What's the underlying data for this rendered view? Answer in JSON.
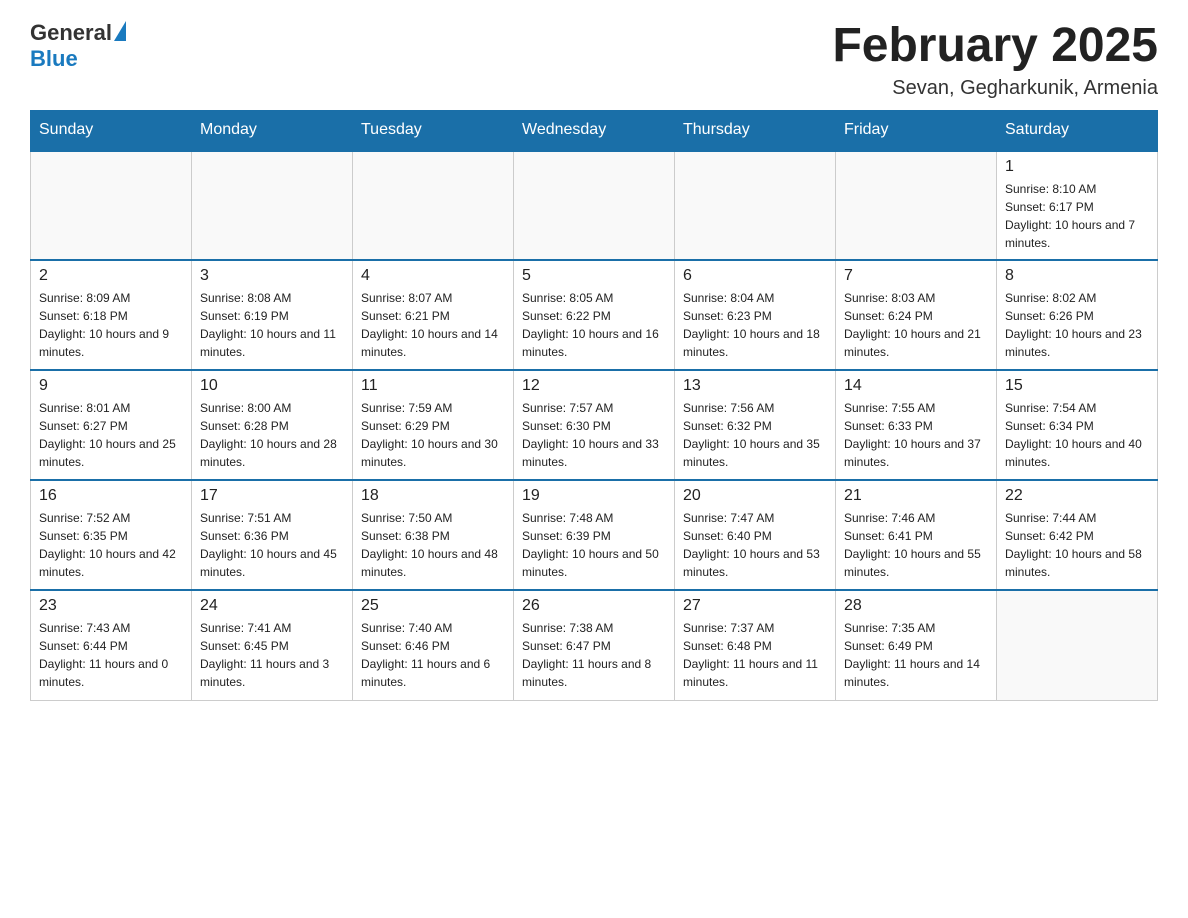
{
  "header": {
    "logo_general": "General",
    "logo_blue": "Blue",
    "month_title": "February 2025",
    "location": "Sevan, Gegharkunik, Armenia"
  },
  "days_of_week": [
    "Sunday",
    "Monday",
    "Tuesday",
    "Wednesday",
    "Thursday",
    "Friday",
    "Saturday"
  ],
  "weeks": [
    [
      {
        "day": "",
        "info": ""
      },
      {
        "day": "",
        "info": ""
      },
      {
        "day": "",
        "info": ""
      },
      {
        "day": "",
        "info": ""
      },
      {
        "day": "",
        "info": ""
      },
      {
        "day": "",
        "info": ""
      },
      {
        "day": "1",
        "info": "Sunrise: 8:10 AM\nSunset: 6:17 PM\nDaylight: 10 hours and 7 minutes."
      }
    ],
    [
      {
        "day": "2",
        "info": "Sunrise: 8:09 AM\nSunset: 6:18 PM\nDaylight: 10 hours and 9 minutes."
      },
      {
        "day": "3",
        "info": "Sunrise: 8:08 AM\nSunset: 6:19 PM\nDaylight: 10 hours and 11 minutes."
      },
      {
        "day": "4",
        "info": "Sunrise: 8:07 AM\nSunset: 6:21 PM\nDaylight: 10 hours and 14 minutes."
      },
      {
        "day": "5",
        "info": "Sunrise: 8:05 AM\nSunset: 6:22 PM\nDaylight: 10 hours and 16 minutes."
      },
      {
        "day": "6",
        "info": "Sunrise: 8:04 AM\nSunset: 6:23 PM\nDaylight: 10 hours and 18 minutes."
      },
      {
        "day": "7",
        "info": "Sunrise: 8:03 AM\nSunset: 6:24 PM\nDaylight: 10 hours and 21 minutes."
      },
      {
        "day": "8",
        "info": "Sunrise: 8:02 AM\nSunset: 6:26 PM\nDaylight: 10 hours and 23 minutes."
      }
    ],
    [
      {
        "day": "9",
        "info": "Sunrise: 8:01 AM\nSunset: 6:27 PM\nDaylight: 10 hours and 25 minutes."
      },
      {
        "day": "10",
        "info": "Sunrise: 8:00 AM\nSunset: 6:28 PM\nDaylight: 10 hours and 28 minutes."
      },
      {
        "day": "11",
        "info": "Sunrise: 7:59 AM\nSunset: 6:29 PM\nDaylight: 10 hours and 30 minutes."
      },
      {
        "day": "12",
        "info": "Sunrise: 7:57 AM\nSunset: 6:30 PM\nDaylight: 10 hours and 33 minutes."
      },
      {
        "day": "13",
        "info": "Sunrise: 7:56 AM\nSunset: 6:32 PM\nDaylight: 10 hours and 35 minutes."
      },
      {
        "day": "14",
        "info": "Sunrise: 7:55 AM\nSunset: 6:33 PM\nDaylight: 10 hours and 37 minutes."
      },
      {
        "day": "15",
        "info": "Sunrise: 7:54 AM\nSunset: 6:34 PM\nDaylight: 10 hours and 40 minutes."
      }
    ],
    [
      {
        "day": "16",
        "info": "Sunrise: 7:52 AM\nSunset: 6:35 PM\nDaylight: 10 hours and 42 minutes."
      },
      {
        "day": "17",
        "info": "Sunrise: 7:51 AM\nSunset: 6:36 PM\nDaylight: 10 hours and 45 minutes."
      },
      {
        "day": "18",
        "info": "Sunrise: 7:50 AM\nSunset: 6:38 PM\nDaylight: 10 hours and 48 minutes."
      },
      {
        "day": "19",
        "info": "Sunrise: 7:48 AM\nSunset: 6:39 PM\nDaylight: 10 hours and 50 minutes."
      },
      {
        "day": "20",
        "info": "Sunrise: 7:47 AM\nSunset: 6:40 PM\nDaylight: 10 hours and 53 minutes."
      },
      {
        "day": "21",
        "info": "Sunrise: 7:46 AM\nSunset: 6:41 PM\nDaylight: 10 hours and 55 minutes."
      },
      {
        "day": "22",
        "info": "Sunrise: 7:44 AM\nSunset: 6:42 PM\nDaylight: 10 hours and 58 minutes."
      }
    ],
    [
      {
        "day": "23",
        "info": "Sunrise: 7:43 AM\nSunset: 6:44 PM\nDaylight: 11 hours and 0 minutes."
      },
      {
        "day": "24",
        "info": "Sunrise: 7:41 AM\nSunset: 6:45 PM\nDaylight: 11 hours and 3 minutes."
      },
      {
        "day": "25",
        "info": "Sunrise: 7:40 AM\nSunset: 6:46 PM\nDaylight: 11 hours and 6 minutes."
      },
      {
        "day": "26",
        "info": "Sunrise: 7:38 AM\nSunset: 6:47 PM\nDaylight: 11 hours and 8 minutes."
      },
      {
        "day": "27",
        "info": "Sunrise: 7:37 AM\nSunset: 6:48 PM\nDaylight: 11 hours and 11 minutes."
      },
      {
        "day": "28",
        "info": "Sunrise: 7:35 AM\nSunset: 6:49 PM\nDaylight: 11 hours and 14 minutes."
      },
      {
        "day": "",
        "info": ""
      }
    ]
  ]
}
